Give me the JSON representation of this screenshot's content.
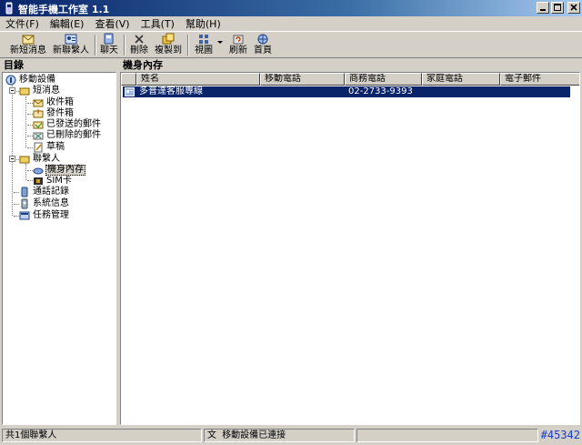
{
  "window": {
    "title": "智能手機工作室 1.1"
  },
  "menu": [
    "文件(F)",
    "編輯(E)",
    "查看(V)",
    "工具(T)",
    "幫助(H)"
  ],
  "toolbar": {
    "new_sms": "新短消息",
    "new_contact": "新聯繫人",
    "chat": "聊天",
    "delete": "刪除",
    "copy_to": "複製到",
    "view": "視圖",
    "refresh": "刷新",
    "home": "首頁"
  },
  "tree": {
    "header": "目錄",
    "root": "移動設備",
    "sms": "短消息",
    "inbox": "收件箱",
    "outbox": "發件箱",
    "sent": "已發送的郵件",
    "deleted": "已刪除的郵件",
    "drafts": "草稿",
    "contacts": "聯繫人",
    "phone_memory": "機身內存",
    "sim": "SIM卡",
    "call_log": "通話記錄",
    "system_info": "系統信息",
    "task_manager": "任務管理"
  },
  "list": {
    "header": "機身內存",
    "columns": [
      "姓名",
      "移動電話",
      "商務電話",
      "家庭電話",
      "電子郵件"
    ],
    "rows": [
      {
        "name": "多普達客服專線",
        "mobile": "",
        "business": "02-2733-9393",
        "home": "",
        "email": ""
      }
    ]
  },
  "status": {
    "count": "共1個聯繫人",
    "ime": "文",
    "connection": "移動設備已連接"
  },
  "tag": "#45342"
}
